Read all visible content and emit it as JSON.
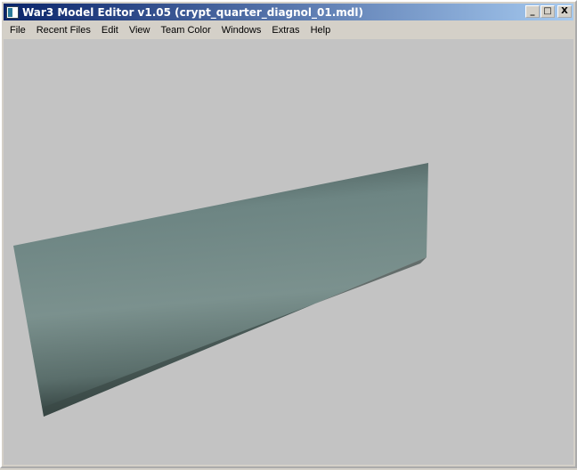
{
  "window": {
    "title": "War3 Model Editor v1.05 (crypt_quarter_diagnol_01.mdl)",
    "minimize": "_",
    "maximize": "□",
    "close": "X"
  },
  "menu": [
    "File",
    "Recent Files",
    "Edit",
    "View",
    "Team Color",
    "Windows",
    "Extras",
    "Help"
  ],
  "colors": {
    "viewport": "#c3c3c3",
    "wall": "#5f7572"
  }
}
